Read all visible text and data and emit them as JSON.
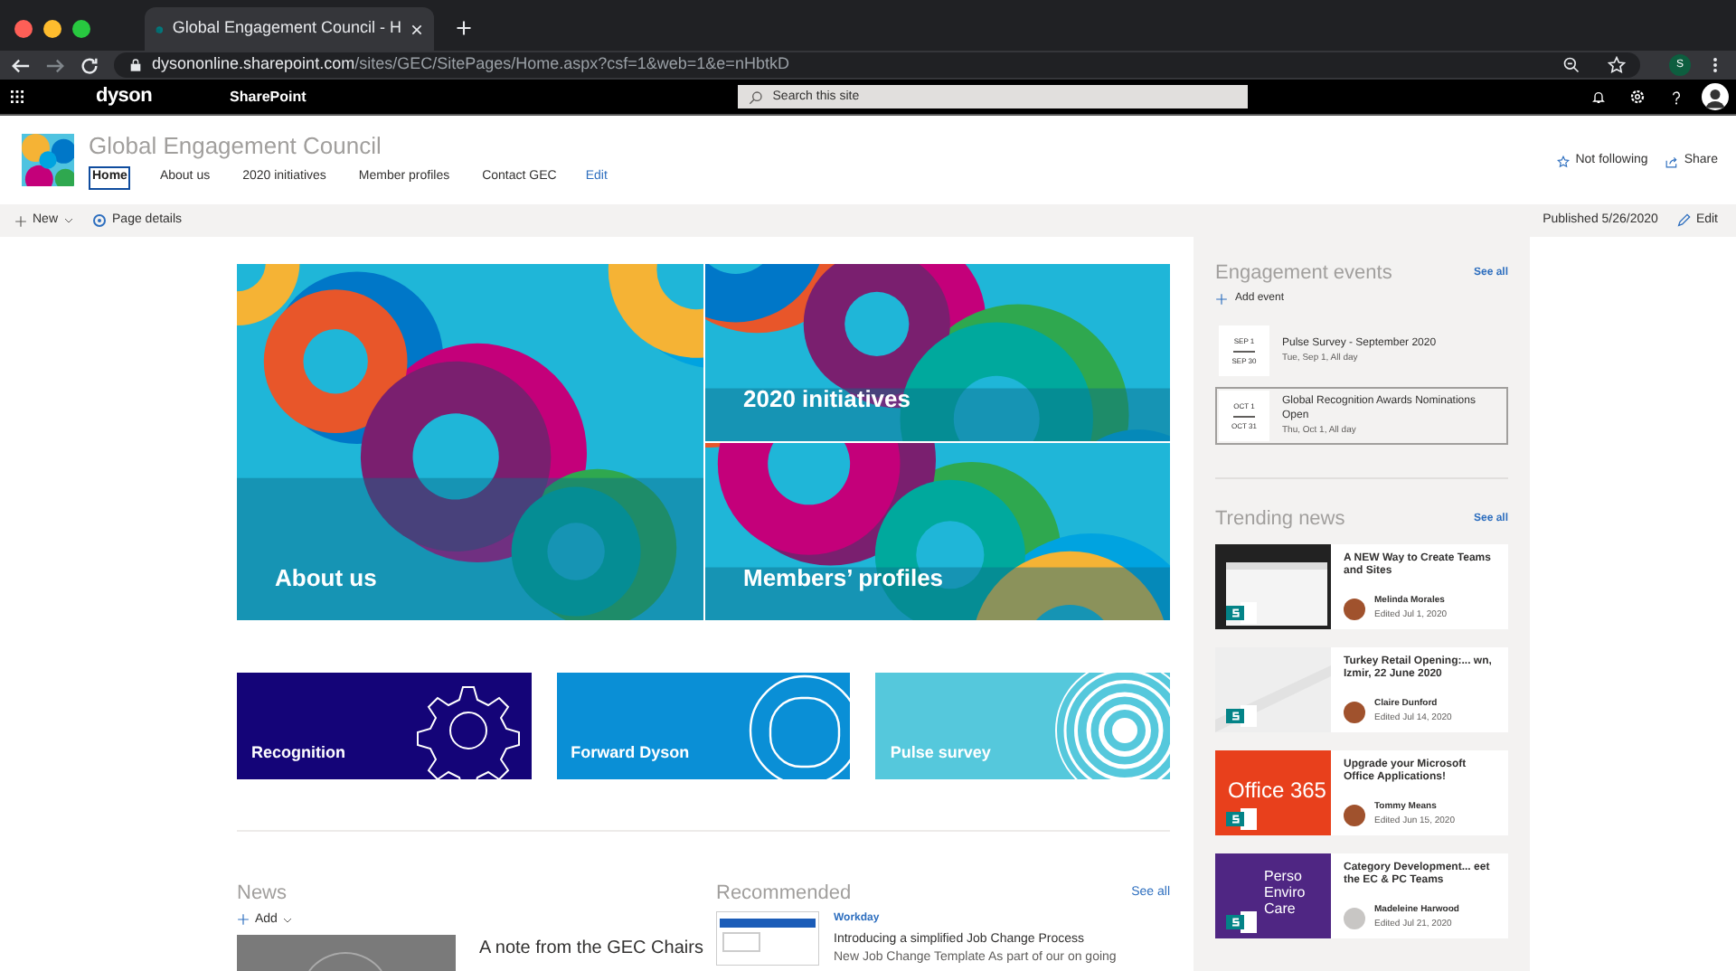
{
  "browser": {
    "tab_title": "Global Engagement Council - H",
    "url_host": "dysononline.sharepoint.com",
    "url_path": "/sites/GEC/SitePages/Home.aspx?csf=1&web=1&e=nHbtkD",
    "profile_initial": "S"
  },
  "suite_bar": {
    "brand": "dyson",
    "app": "SharePoint",
    "search": {
      "placeholder": "Search this site"
    }
  },
  "site": {
    "title": "Global Engagement Council",
    "nav": [
      {
        "label": "Home",
        "selected": true
      },
      {
        "label": "About us",
        "selected": false
      },
      {
        "label": "2020 initiatives",
        "selected": false
      },
      {
        "label": "Member profiles",
        "selected": false
      },
      {
        "label": "Contact GEC",
        "selected": false
      }
    ],
    "edit_link": "Edit",
    "follow": "Not following",
    "share": "Share"
  },
  "command_bar": {
    "new": "New",
    "page_details": "Page details",
    "published": "Published 5/26/2020",
    "edit": "Edit"
  },
  "hero": [
    {
      "title": "About us"
    },
    {
      "title": "2020 initiatives"
    },
    {
      "title": "Members’ profiles"
    }
  ],
  "quick_links": [
    {
      "title": "Recognition",
      "kind": "gear",
      "color": "#140478"
    },
    {
      "title": "Forward Dyson",
      "kind": "ring",
      "color": "#0a8fd6"
    },
    {
      "title": "Pulse survey",
      "kind": "target",
      "color": "#55c8dc"
    }
  ],
  "news": {
    "heading": "News",
    "add": "Add",
    "article_title": "A note from the GEC Chairs"
  },
  "recommended": {
    "heading": "Recommended",
    "see_all": "See all",
    "item": {
      "source": "Workday",
      "title": "Introducing a simplified Job Change Process",
      "snippet": "New Job Change Template As part of our on going"
    }
  },
  "events": {
    "heading": "Engagement events",
    "see_all": "See all",
    "add": "Add event",
    "items": [
      {
        "start": "SEP 1",
        "end": "SEP 30",
        "title": "Pulse Survey - September 2020",
        "when": "Tue, Sep 1, All day",
        "selected": false
      },
      {
        "start": "OCT 1",
        "end": "OCT 31",
        "title": "Global Recognition Awards Nominations Open",
        "when": "Thu, Oct 1, All day",
        "selected": true
      }
    ]
  },
  "trending": {
    "heading": "Trending news",
    "see_all": "See all",
    "items": [
      {
        "kind": "screenshot",
        "title": "A NEW Way to Create Teams and Sites",
        "author": "Melinda Morales",
        "edited": "Edited Jul 1, 2020"
      },
      {
        "kind": "plain",
        "title": "Turkey Retail Opening:... wn, Izmir, 22 June 2020",
        "author": "Claire Dunford",
        "edited": "Edited Jul 14, 2020"
      },
      {
        "kind": "office",
        "thumb_text": "Office 365",
        "title": "Upgrade your Microsoft Office Applications!",
        "author": "Tommy Means",
        "edited": "Edited Jun 15, 2020"
      },
      {
        "kind": "purple",
        "thumb_lines": [
          "Perso",
          "Enviro",
          "Care"
        ],
        "title": "Category Development... eet the EC & PC Teams",
        "author": "Madeleine Harwood",
        "edited": "Edited Jul 21, 2020",
        "generic_avatar": true
      }
    ]
  }
}
